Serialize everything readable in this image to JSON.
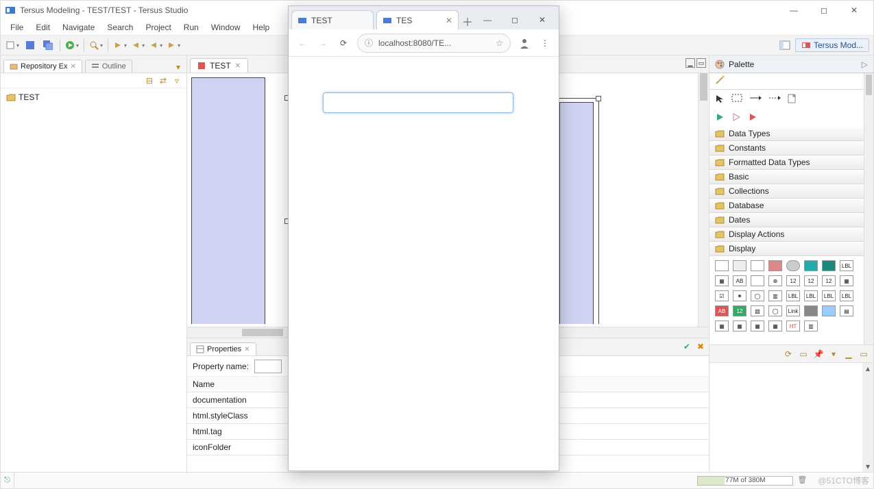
{
  "ide": {
    "title": "Tersus Modeling - TEST/TEST - Tersus Studio",
    "menus": [
      "File",
      "Edit",
      "Navigate",
      "Search",
      "Project",
      "Run",
      "Window",
      "Help"
    ],
    "perspective": "Tersus Mod...",
    "repository": {
      "tab": "Repository Ex",
      "outline_tab": "Outline",
      "tree_root": "TEST"
    },
    "editor": {
      "tab": "TEST"
    },
    "palette": {
      "title": "Palette",
      "drawers": [
        "Data Types",
        "Constants",
        "Formatted Data Types",
        "Basic",
        "Collections",
        "Database",
        "Dates",
        "Display Actions",
        "Display"
      ]
    },
    "properties": {
      "tab": "Properties",
      "filter_label": "Property name:",
      "header": "Name",
      "rows": [
        "documentation",
        "html.styleClass",
        "html.tag",
        "iconFolder"
      ]
    },
    "status": {
      "heap": "77M of 380M"
    },
    "watermark": "@51CTO博客"
  },
  "browser": {
    "tabs": [
      {
        "title": "TEST",
        "active": false
      },
      {
        "title": "TES",
        "active": true
      }
    ],
    "url": "localhost:8080/TE..."
  }
}
